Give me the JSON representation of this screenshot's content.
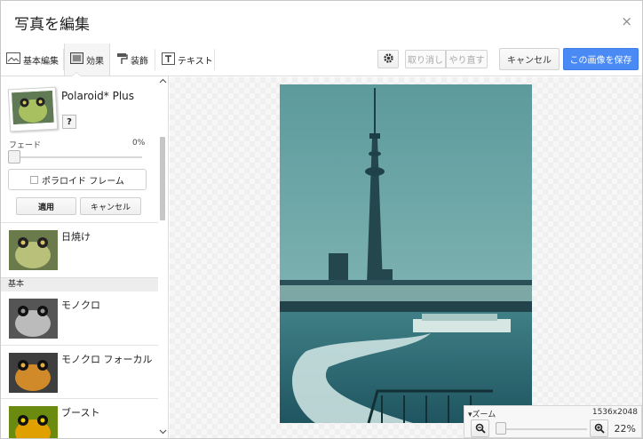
{
  "window": {
    "title": "写真を編集",
    "close_glyph": "×"
  },
  "tabs": [
    {
      "label": "基本編集",
      "icon": "image-icon"
    },
    {
      "label": "効果",
      "icon": "effects-icon",
      "active": true
    },
    {
      "label": "装飾",
      "icon": "paint-roller-icon"
    },
    {
      "label": "テキスト",
      "icon": "text-icon"
    }
  ],
  "toolbar": {
    "settings_icon": "gear-icon",
    "undo_label": "取り消し",
    "redo_label": "やり直す",
    "cancel_label": "キャンセル",
    "save_label": "この画像を保存"
  },
  "effect": {
    "name": "Polaroid* Plus",
    "help_label": "?",
    "fade_label": "フェード",
    "fade_value": "0%",
    "fade_fraction": 0,
    "frame_label": "ポラロイド フレーム",
    "frame_checked": false,
    "apply_label": "適用",
    "cancel_label": "キャンセル"
  },
  "effects_list": [
    {
      "label": "日焼け"
    }
  ],
  "section_basic": "基本",
  "basic_list": [
    {
      "label": "モノクロ"
    },
    {
      "label": "モノクロ フォーカル"
    },
    {
      "label": "ブースト"
    }
  ],
  "zoom": {
    "title": "ズーム",
    "dimensions": "1536x2048",
    "percent": "22%",
    "fraction": 0.22
  },
  "colors": {
    "accent": "#4a8af4",
    "photo_sky": "#6aa5a5",
    "photo_water": "#2f6f79"
  }
}
